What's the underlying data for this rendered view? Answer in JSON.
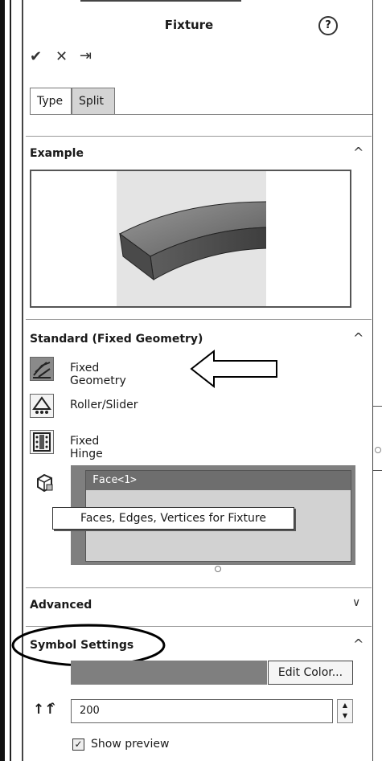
{
  "panel": {
    "title": "Fixture",
    "help_label": "?",
    "toolbar": {
      "ok": "✔",
      "cancel": "✕",
      "pin": "⇥"
    }
  },
  "tabs": [
    {
      "label": "Type",
      "active": true
    },
    {
      "label": "Split",
      "active": false
    }
  ],
  "example": {
    "title": "Example"
  },
  "standard": {
    "title": "Standard (Fixed Geometry)",
    "items": [
      {
        "label": "Fixed Geometry",
        "icon": "fixed-geometry-icon",
        "selected": true
      },
      {
        "label": "Roller/Slider",
        "icon": "roller-slider-icon",
        "selected": false
      },
      {
        "label": "Fixed Hinge",
        "icon": "fixed-hinge-icon",
        "selected": false
      }
    ],
    "selection": {
      "items": [
        "Face<1>"
      ],
      "tooltip": "Faces, Edges, Vertices for Fixture"
    }
  },
  "advanced": {
    "title": "Advanced"
  },
  "symbol_settings": {
    "title": "Symbol Settings",
    "edit_color_label": "Edit Color...",
    "size_value": "200",
    "show_preview_label": "Show preview",
    "show_preview_checked": true,
    "color": "#7f7f7f"
  }
}
